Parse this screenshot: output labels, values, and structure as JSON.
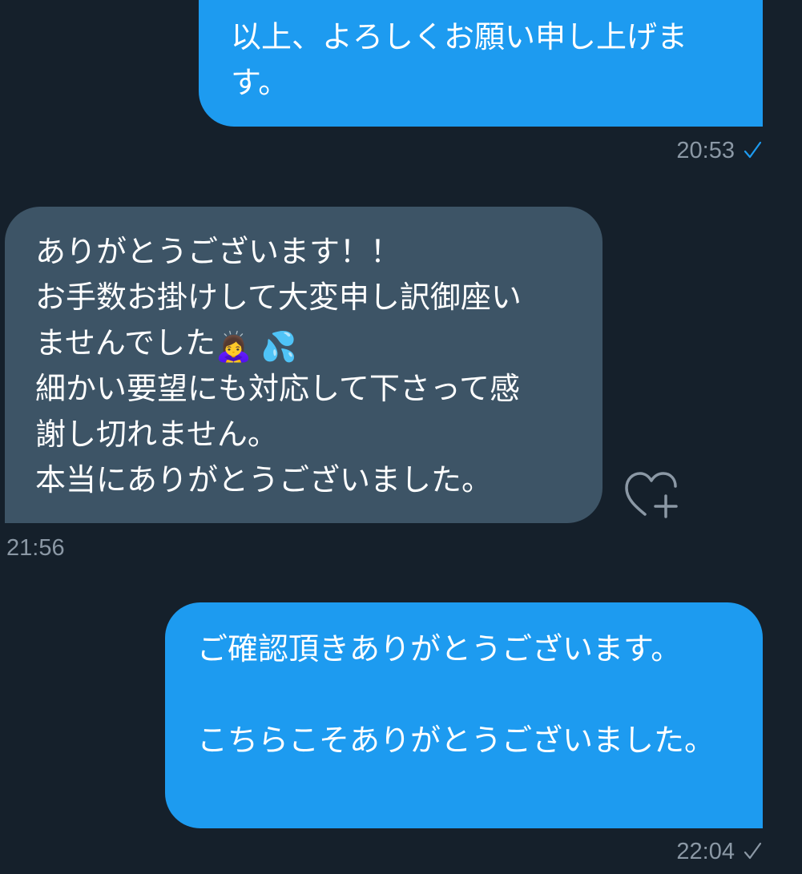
{
  "messages": [
    {
      "direction": "sent",
      "text": "以上、よろしくお願い申し上げます。",
      "time": "20:53",
      "status_icon": "check-icon",
      "status_color": "#1d9bf0"
    },
    {
      "direction": "received",
      "lines": {
        "l1": "ありがとうございます！！",
        "l2": "お手数お掛けして大変申し訳御座い",
        "l3": "ませんでした",
        "l4": "細かい要望にも対応して下さって感",
        "l5": "謝し切れません。",
        "l6": "本当にありがとうございました。"
      },
      "emoji": {
        "bowing": "🙇‍♀️",
        "sweat": "💦"
      },
      "time": "21:56",
      "reaction_icon": "heart-plus-icon"
    },
    {
      "direction": "sent",
      "text": "ご確認頂きありがとうございます。\n\nこちらこそありがとうございました。",
      "time": "22:04",
      "status_icon": "check-icon",
      "status_color": "#8b98a5"
    }
  ],
  "colors": {
    "background": "#15202b",
    "sent_bubble": "#1d9bf0",
    "received_bubble": "#3d5466",
    "text": "#ffffff",
    "meta_text": "#8b98a5"
  }
}
